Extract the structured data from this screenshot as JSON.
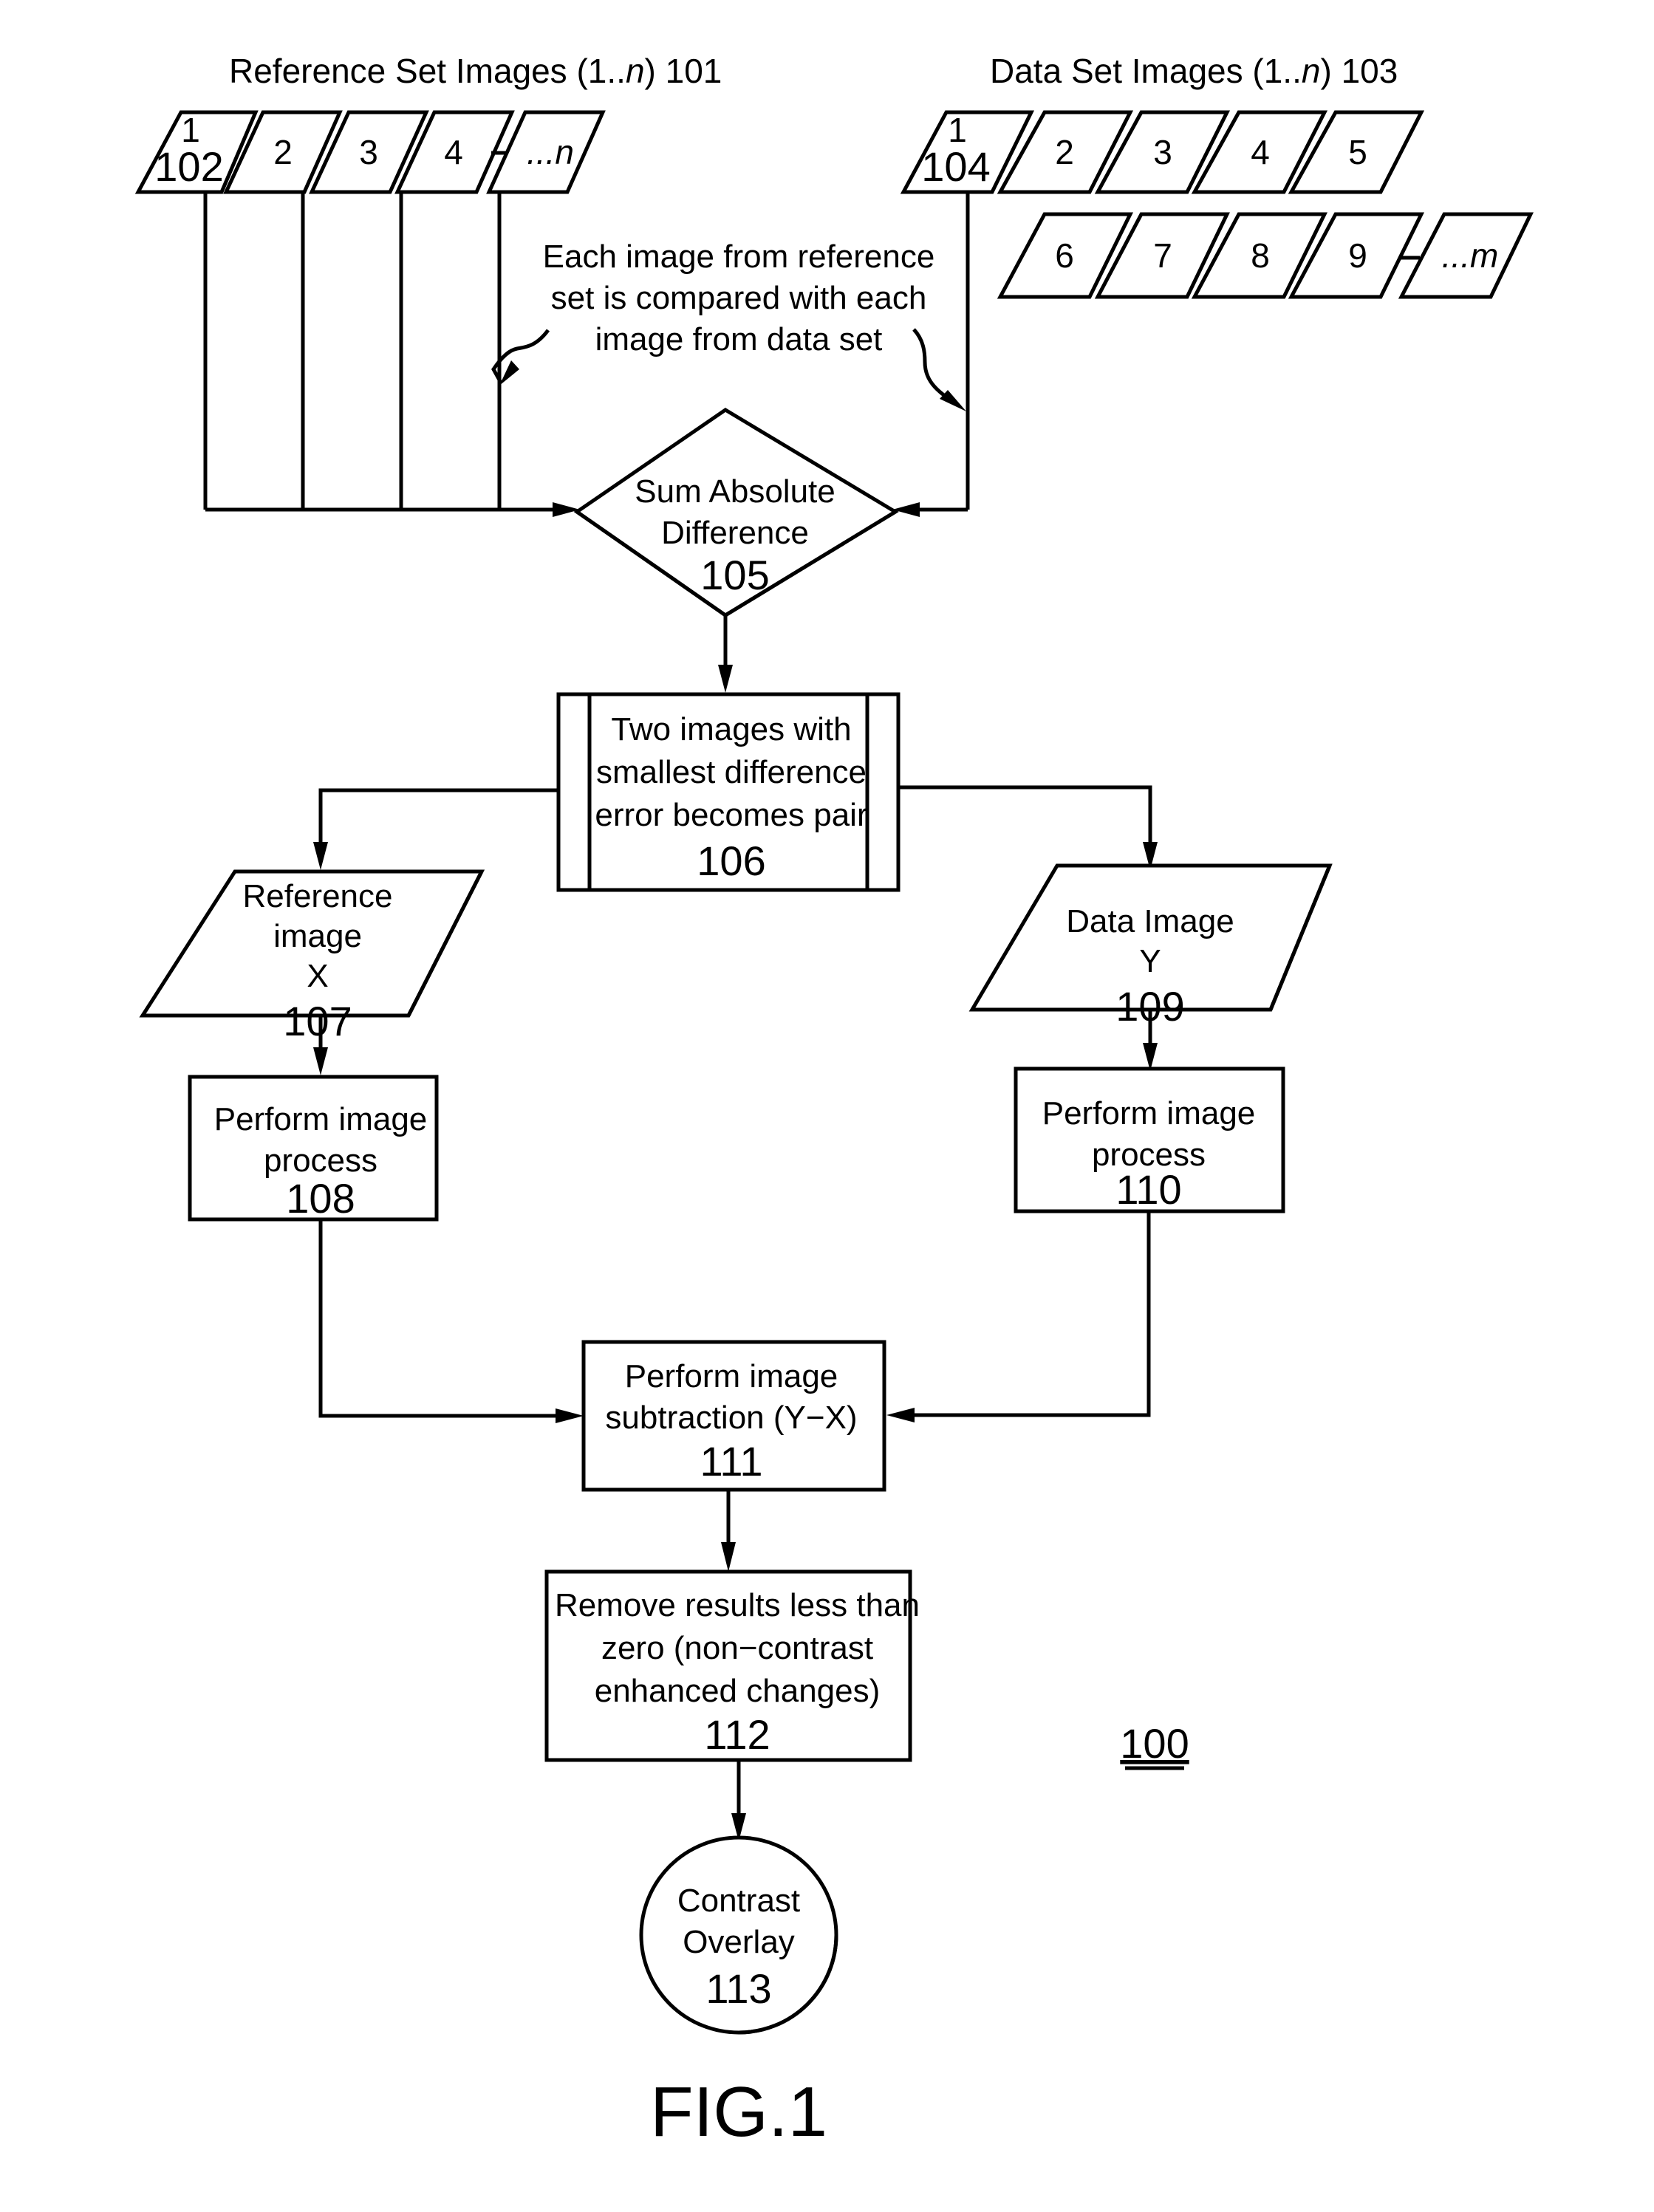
{
  "figure": {
    "label": "FIG.1",
    "reference_numeral": "100"
  },
  "reference_set": {
    "title": "Reference Set Images (1..n) 101",
    "title_text": "Reference Set Images (1..",
    "title_italic": "n",
    "title_suffix": ") 101",
    "images": [
      {
        "label": "1",
        "ref": "102"
      },
      {
        "label": "2"
      },
      {
        "label": "3"
      },
      {
        "label": "4"
      },
      {
        "label": "...n"
      }
    ]
  },
  "data_set": {
    "title": "Data Set Images (1..n) 103",
    "title_text": "Data Set Images (1..",
    "title_italic": "n",
    "title_suffix": ") 103",
    "images_row1": [
      {
        "label": "1",
        "ref": "104"
      },
      {
        "label": "2"
      },
      {
        "label": "3"
      },
      {
        "label": "4"
      },
      {
        "label": "5"
      }
    ],
    "images_row2": [
      {
        "label": "6"
      },
      {
        "label": "7"
      },
      {
        "label": "8"
      },
      {
        "label": "9"
      },
      {
        "label": "...m"
      }
    ]
  },
  "annotation": {
    "lines": [
      "Each image from reference",
      "set is compared with each",
      "image from data set"
    ]
  },
  "nodes": {
    "sad": {
      "lines": [
        "Sum Absolute",
        "Difference"
      ],
      "ref": "105",
      "shape": "decision"
    },
    "pair": {
      "lines": [
        "Two images with",
        "smallest difference",
        "error becomes pair"
      ],
      "ref": "106",
      "shape": "predefined-process"
    },
    "ref_image": {
      "lines": [
        "Reference",
        "image",
        "X"
      ],
      "ref": "107",
      "shape": "data"
    },
    "data_image": {
      "lines": [
        "Data Image",
        "Y"
      ],
      "ref": "109",
      "shape": "data"
    },
    "process_x": {
      "lines": [
        "Perform image",
        "process"
      ],
      "ref": "108",
      "shape": "process"
    },
    "process_y": {
      "lines": [
        "Perform image",
        "process"
      ],
      "ref": "110",
      "shape": "process"
    },
    "subtract": {
      "lines": [
        "Perform image",
        "subtraction (Y−X)"
      ],
      "ref": "111",
      "shape": "process"
    },
    "remove": {
      "lines": [
        "Remove results less than",
        "zero (non−contrast",
        "enhanced changes)"
      ],
      "ref": "112",
      "shape": "process"
    },
    "overlay": {
      "lines": [
        "Contrast",
        "Overlay"
      ],
      "ref": "113",
      "shape": "terminal-circle"
    }
  },
  "edges": [
    {
      "from": "reference_set",
      "to": "sad"
    },
    {
      "from": "data_set",
      "to": "sad"
    },
    {
      "from": "sad",
      "to": "pair"
    },
    {
      "from": "pair",
      "to": "ref_image"
    },
    {
      "from": "pair",
      "to": "data_image"
    },
    {
      "from": "ref_image",
      "to": "process_x"
    },
    {
      "from": "data_image",
      "to": "process_y"
    },
    {
      "from": "process_x",
      "to": "subtract"
    },
    {
      "from": "process_y",
      "to": "subtract"
    },
    {
      "from": "subtract",
      "to": "remove"
    },
    {
      "from": "remove",
      "to": "overlay"
    }
  ]
}
